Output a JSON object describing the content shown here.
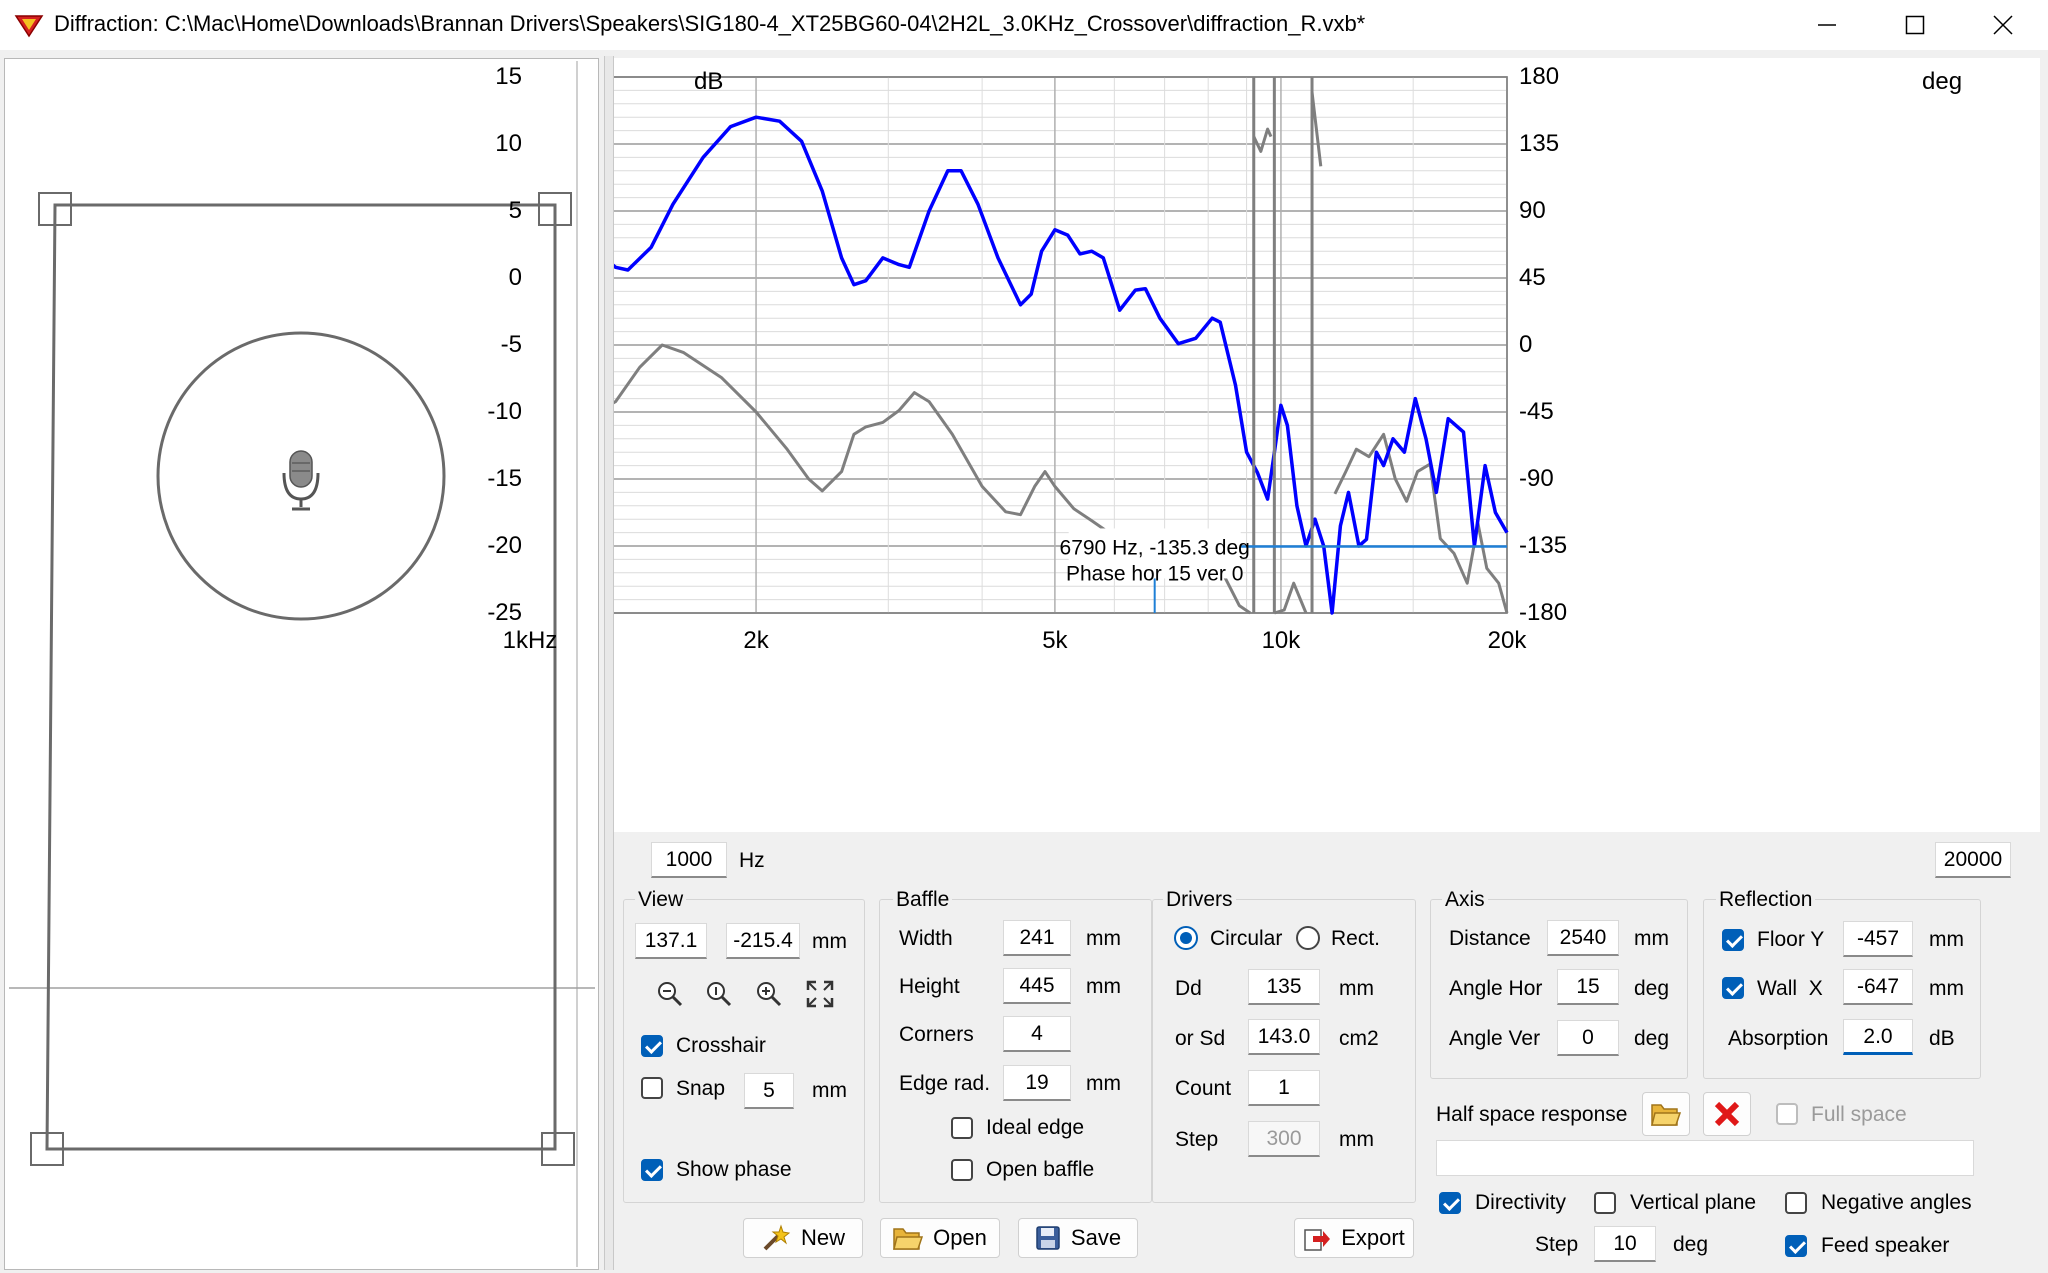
{
  "window": {
    "title": "Diffraction: C:\\Mac\\Home\\Downloads\\Brannan Drivers\\Speakers\\SIG180-4_XT25BG60-04\\2H2L_3.0KHz_Crossover\\diffraction_R.vxb*",
    "minimize_glyph": "—",
    "maximize_glyph": "☐",
    "close_glyph": "✕"
  },
  "chart_data": {
    "type": "line",
    "y_left_unit": "dB",
    "y_right_unit": "deg",
    "x_scale": "log",
    "xlim": [
      1000,
      20000
    ],
    "ylim_left": [
      -25,
      15
    ],
    "ylim_right": [
      -180,
      180
    ],
    "x_tick_labels": [
      "1kHz",
      "2k",
      "5k",
      "10k",
      "20k"
    ],
    "y_left_ticks": [
      "15",
      "10",
      "5",
      "0",
      "-5",
      "-10",
      "-15",
      "-20",
      "-25"
    ],
    "y_right_ticks": [
      "180",
      "135",
      "90",
      "45",
      "0",
      "-45",
      "-90",
      "-135",
      "-180"
    ],
    "grid": true,
    "series": [
      {
        "color": "#0000ff",
        "axis": "left",
        "points": [
          [
            1000,
            4.5
          ],
          [
            1100,
            4.0
          ],
          [
            1200,
            2.5
          ],
          [
            1300,
            0.8
          ],
          [
            1350,
            0.6
          ],
          [
            1450,
            2.3
          ],
          [
            1550,
            5.5
          ],
          [
            1700,
            9.0
          ],
          [
            1850,
            11.3
          ],
          [
            2000,
            12.0
          ],
          [
            2150,
            11.7
          ],
          [
            2300,
            10.2
          ],
          [
            2450,
            6.5
          ],
          [
            2600,
            1.5
          ],
          [
            2700,
            -0.5
          ],
          [
            2800,
            -0.2
          ],
          [
            2950,
            1.5
          ],
          [
            3100,
            1.0
          ],
          [
            3200,
            0.8
          ],
          [
            3400,
            5.0
          ],
          [
            3600,
            8.0
          ],
          [
            3750,
            8.0
          ],
          [
            3950,
            5.5
          ],
          [
            4200,
            1.5
          ],
          [
            4500,
            -2.0
          ],
          [
            4650,
            -1.2
          ],
          [
            4800,
            2.0
          ],
          [
            5000,
            3.6
          ],
          [
            5200,
            3.2
          ],
          [
            5400,
            1.8
          ],
          [
            5600,
            2.0
          ],
          [
            5800,
            1.5
          ],
          [
            6100,
            -2.4
          ],
          [
            6400,
            -0.9
          ],
          [
            6600,
            -0.8
          ],
          [
            6900,
            -3.0
          ],
          [
            7300,
            -4.9
          ],
          [
            7700,
            -4.5
          ],
          [
            8100,
            -3.0
          ],
          [
            8300,
            -3.3
          ],
          [
            8700,
            -8.0
          ],
          [
            9000,
            -13.0
          ],
          [
            9300,
            -14.5
          ],
          [
            9600,
            -16.5
          ],
          [
            9800,
            -13.0
          ],
          [
            10000,
            -9.5
          ],
          [
            10200,
            -11.0
          ],
          [
            10500,
            -17.0
          ],
          [
            10800,
            -20.0
          ],
          [
            11100,
            -18.0
          ],
          [
            11400,
            -20.0
          ],
          [
            11700,
            -25.0
          ],
          [
            12000,
            -18.5
          ],
          [
            12300,
            -16.0
          ],
          [
            12700,
            -20.0
          ],
          [
            13000,
            -19.5
          ],
          [
            13400,
            -13.0
          ],
          [
            13700,
            -14.0
          ],
          [
            14100,
            -12.0
          ],
          [
            14600,
            -13.0
          ],
          [
            15100,
            -9.0
          ],
          [
            15600,
            -12.0
          ],
          [
            16100,
            -16.0
          ],
          [
            16700,
            -10.5
          ],
          [
            17500,
            -11.5
          ],
          [
            18100,
            -20.0
          ],
          [
            18700,
            -14.0
          ],
          [
            19300,
            -17.5
          ],
          [
            20000,
            -19.0
          ]
        ]
      },
      {
        "color": "#7f7f7f",
        "axis": "right",
        "points": [
          [
            1000,
            -43
          ],
          [
            1100,
            -48
          ],
          [
            1200,
            -48
          ],
          [
            1300,
            -38
          ],
          [
            1400,
            -15
          ],
          [
            1500,
            0
          ],
          [
            1600,
            -5
          ],
          [
            1800,
            -22
          ],
          [
            2000,
            -45
          ],
          [
            2200,
            -70
          ],
          [
            2350,
            -90
          ],
          [
            2450,
            -98
          ],
          [
            2600,
            -85
          ],
          [
            2700,
            -60
          ],
          [
            2800,
            -55
          ],
          [
            2950,
            -52
          ],
          [
            3100,
            -44
          ],
          [
            3250,
            -32
          ],
          [
            3400,
            -38
          ],
          [
            3650,
            -60
          ],
          [
            4000,
            -95
          ],
          [
            4300,
            -112
          ],
          [
            4500,
            -114
          ],
          [
            4700,
            -95
          ],
          [
            4850,
            -85
          ],
          [
            5000,
            -95
          ],
          [
            5300,
            -110
          ],
          [
            5600,
            -118
          ],
          [
            5900,
            -126
          ],
          [
            6200,
            -140
          ],
          [
            6600,
            -145
          ],
          [
            6900,
            -140
          ],
          [
            7200,
            -130
          ],
          [
            7600,
            -132
          ],
          [
            8000,
            -145
          ],
          [
            8400,
            -155
          ],
          [
            8800,
            -175
          ],
          [
            9100,
            -180
          ],
          [
            9200,
            140
          ],
          [
            9400,
            130
          ],
          [
            9600,
            145
          ],
          [
            9700,
            140
          ],
          [
            9800,
            -180
          ],
          [
            10100,
            -178
          ],
          [
            10400,
            -160
          ],
          [
            10800,
            -180
          ],
          [
            11000,
            170
          ],
          [
            11300,
            120
          ],
          [
            11800,
            -100
          ],
          [
            12200,
            -85
          ],
          [
            12600,
            -70
          ],
          [
            13100,
            -75
          ],
          [
            13700,
            -60
          ],
          [
            14200,
            -90
          ],
          [
            14700,
            -105
          ],
          [
            15200,
            -85
          ],
          [
            15800,
            -80
          ],
          [
            16300,
            -130
          ],
          [
            17000,
            -140
          ],
          [
            17700,
            -160
          ],
          [
            18300,
            -120
          ],
          [
            18800,
            -150
          ],
          [
            19500,
            -160
          ],
          [
            20000,
            -180
          ]
        ]
      }
    ],
    "cursor": {
      "freq": 6790,
      "label_line1": "6790 Hz, -135.3 deg",
      "label_line2": "Phase hor 15 ver 0"
    }
  },
  "freq_range": {
    "min": "1000",
    "min_unit": "Hz",
    "max": "20000"
  },
  "view": {
    "legend": "View",
    "x": "137.1",
    "y": "-215.4",
    "unit": "mm",
    "crosshair_label": "Crosshair",
    "crosshair": true,
    "snap_label": "Snap",
    "snap": false,
    "snap_value": "5",
    "snap_unit": "mm",
    "show_phase_label": "Show phase",
    "show_phase": true
  },
  "baffle": {
    "legend": "Baffle",
    "width_label": "Width",
    "width": "241",
    "width_unit": "mm",
    "height_label": "Height",
    "height": "445",
    "height_unit": "mm",
    "corners_label": "Corners",
    "corners": "4",
    "edge_label": "Edge rad.",
    "edge": "19",
    "edge_unit": "mm",
    "ideal_edge_label": "Ideal edge",
    "ideal_edge": false,
    "open_baffle_label": "Open baffle",
    "open_baffle": false
  },
  "drivers": {
    "legend": "Drivers",
    "circular_label": "Circular",
    "rect_label": "Rect.",
    "shape": "circular",
    "dd_label": "Dd",
    "dd": "135",
    "dd_unit": "mm",
    "sd_label": "or Sd",
    "sd": "143.0",
    "sd_unit": "cm2",
    "count_label": "Count",
    "count": "1",
    "step_label": "Step",
    "step": "300",
    "step_unit": "mm"
  },
  "axis": {
    "legend": "Axis",
    "distance_label": "Distance",
    "distance": "2540",
    "distance_unit": "mm",
    "hor_label": "Angle Hor",
    "hor": "15",
    "hor_unit": "deg",
    "ver_label": "Angle Ver",
    "ver": "0",
    "ver_unit": "deg"
  },
  "reflection": {
    "legend": "Reflection",
    "floor_label": "Floor Y",
    "floor": true,
    "floor_value": "-457",
    "floor_unit": "mm",
    "wall_label": "Wall  X",
    "wall": true,
    "wall_value": "-647",
    "wall_unit": "mm",
    "absorption_label": "Absorption",
    "absorption": "2.0",
    "absorption_unit": "dB"
  },
  "half_space": {
    "label": "Half space response",
    "full_space_label": "Full space",
    "full_space": false,
    "file": ""
  },
  "options": {
    "directivity_label": "Directivity",
    "directivity": true,
    "vertical_label": "Vertical plane",
    "vertical": false,
    "negative_label": "Negative angles",
    "negative": false,
    "step_label": "Step",
    "step": "10",
    "step_unit": "deg",
    "feed_label": "Feed speaker",
    "feed": true
  },
  "buttons": {
    "new": "New",
    "open": "Open",
    "save": "Save",
    "export": "Export"
  }
}
